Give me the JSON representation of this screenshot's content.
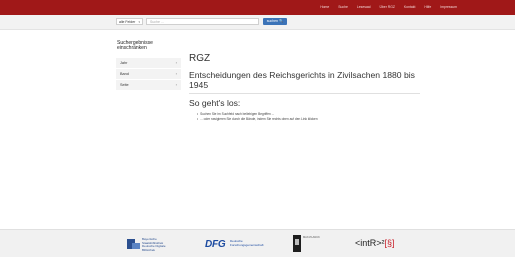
{
  "topnav": [
    "Home",
    "Suche",
    "Lesesaal",
    "Über RGZ",
    "Kontakt",
    "Hilfe",
    "Impressum"
  ],
  "search": {
    "select_value": "alle Felder",
    "placeholder": "Suche ...",
    "button_label": "suchen 🔍"
  },
  "sidebar": {
    "title": "Suchergebnisse einschränken",
    "facets": [
      {
        "label": "Jahr"
      },
      {
        "label": "Band"
      },
      {
        "label": "Seite"
      }
    ]
  },
  "main": {
    "brand": "RGZ",
    "heading": "Entscheidungen des Reichsgerichts in Zivilsachen 1880 bis 1945",
    "subheading": "So geht's los:",
    "intro": [
      "Suchen Sie im Suchfeld nach beliebigen Begriffen ...",
      "... oder navigieren Sie durch die Bände, indem Sie rechts oben auf den Link klicken"
    ]
  },
  "footer": {
    "bay_lines": [
      "Bayerische",
      "Staatsbibliothek",
      "Deutsche Digitale Bibliothek"
    ],
    "dfg": "DFG",
    "dfg_lines": [
      "Deutsche",
      "Forschungsgemeinschaft"
    ],
    "mpi": "MAX-PLANCK",
    "intr": "<intR>²[§]"
  },
  "colors": {
    "topbar": "#a01818",
    "accent": "#3b73b8",
    "dfg_blue": "#1b4aa0",
    "intr_red": "#c81e28"
  }
}
